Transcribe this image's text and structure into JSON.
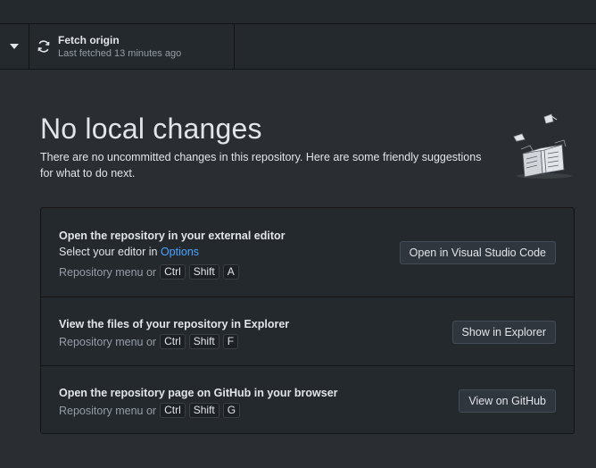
{
  "toolbar": {
    "fetch_title": "Fetch origin",
    "fetch_subtitle": "Last fetched 13 minutes ago"
  },
  "main": {
    "heading": "No local changes",
    "description": "There are no uncommitted changes in this repository. Here are some friendly suggestions for what to do next."
  },
  "suggestions": [
    {
      "title": "Open the repository in your external editor",
      "desc_prefix": "Select your editor in ",
      "desc_link": "Options",
      "shortcut_prefix": "Repository menu or",
      "keys": [
        "Ctrl",
        "Shift",
        "A"
      ],
      "button": "Open in Visual Studio Code"
    },
    {
      "title": "View the files of your repository in Explorer",
      "shortcut_prefix": "Repository menu or",
      "keys": [
        "Ctrl",
        "Shift",
        "F"
      ],
      "button": "Show in Explorer"
    },
    {
      "title": "Open the repository page on GitHub in your browser",
      "shortcut_prefix": "Repository menu or",
      "keys": [
        "Ctrl",
        "Shift",
        "G"
      ],
      "button": "View on GitHub"
    }
  ],
  "colors": {
    "background": "#24292e",
    "content_bg": "#2a2e33",
    "link": "#4aa3ff"
  },
  "icons": {
    "dropdown": "caret-down-icon",
    "fetch": "sync-icon",
    "illustration": "papers-box-illustration"
  }
}
